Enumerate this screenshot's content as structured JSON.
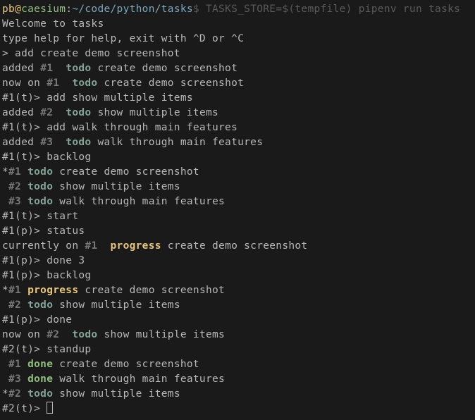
{
  "prompt": {
    "user": "pb",
    "at": "@",
    "host": "caesium",
    "colon": ":",
    "path": "~/code/python/tasks",
    "dollar": "$ ",
    "command": "TASKS_STORE=$(tempfile) pipenv run tasks"
  },
  "lines": [
    {
      "t": "plain",
      "text": "Welcome to tasks"
    },
    {
      "t": "plain",
      "text": "type help for help, exit with ^D or ^C"
    },
    {
      "t": "plain",
      "text": "> add create demo screenshot"
    },
    {
      "t": "added",
      "pre": "added ",
      "num": "#1",
      "status": "todo",
      "desc": " create demo screenshot"
    },
    {
      "t": "nowon",
      "pre": "now on ",
      "num": "#1",
      "status": "todo",
      "desc": " create demo screenshot"
    },
    {
      "t": "plain",
      "text": "#1(t)> add show multiple items"
    },
    {
      "t": "added",
      "pre": "added ",
      "num": "#2",
      "status": "todo",
      "desc": " show multiple items"
    },
    {
      "t": "plain",
      "text": "#1(t)> add walk through main features"
    },
    {
      "t": "added",
      "pre": "added ",
      "num": "#3",
      "status": "todo",
      "desc": " walk through main features"
    },
    {
      "t": "plain",
      "text": "#1(t)> backlog"
    },
    {
      "t": "item",
      "pre": "*",
      "num": "#1",
      "status": "todo",
      "desc": " create demo screenshot"
    },
    {
      "t": "item",
      "pre": " ",
      "num": "#2",
      "status": "todo",
      "desc": " show multiple items"
    },
    {
      "t": "item",
      "pre": " ",
      "num": "#3",
      "status": "todo",
      "desc": " walk through main features"
    },
    {
      "t": "plain",
      "text": "#1(t)> start"
    },
    {
      "t": "plain",
      "text": "#1(p)> status"
    },
    {
      "t": "curon",
      "pre": "currently on ",
      "num": "#1",
      "status": "progress",
      "desc": " create demo screenshot"
    },
    {
      "t": "plain",
      "text": "#1(p)> done 3"
    },
    {
      "t": "plain",
      "text": "#1(p)> backlog"
    },
    {
      "t": "item",
      "pre": "*",
      "num": "#1",
      "status": "progress",
      "desc": " create demo screenshot"
    },
    {
      "t": "item",
      "pre": " ",
      "num": "#2",
      "status": "todo",
      "desc": " show multiple items"
    },
    {
      "t": "plain",
      "text": "#1(p)> done"
    },
    {
      "t": "nowon",
      "pre": "now on ",
      "num": "#2",
      "status": "todo",
      "desc": " show multiple items"
    },
    {
      "t": "plain",
      "text": "#2(t)> standup"
    },
    {
      "t": "item",
      "pre": " ",
      "num": "#1",
      "status": "done",
      "desc": " create demo screenshot"
    },
    {
      "t": "item",
      "pre": " ",
      "num": "#3",
      "status": "done",
      "desc": " walk through main features"
    },
    {
      "t": "item",
      "pre": "*",
      "num": "#2",
      "status": "todo",
      "desc": " show multiple items"
    },
    {
      "t": "cursorline",
      "text": "#2(t)> "
    }
  ]
}
